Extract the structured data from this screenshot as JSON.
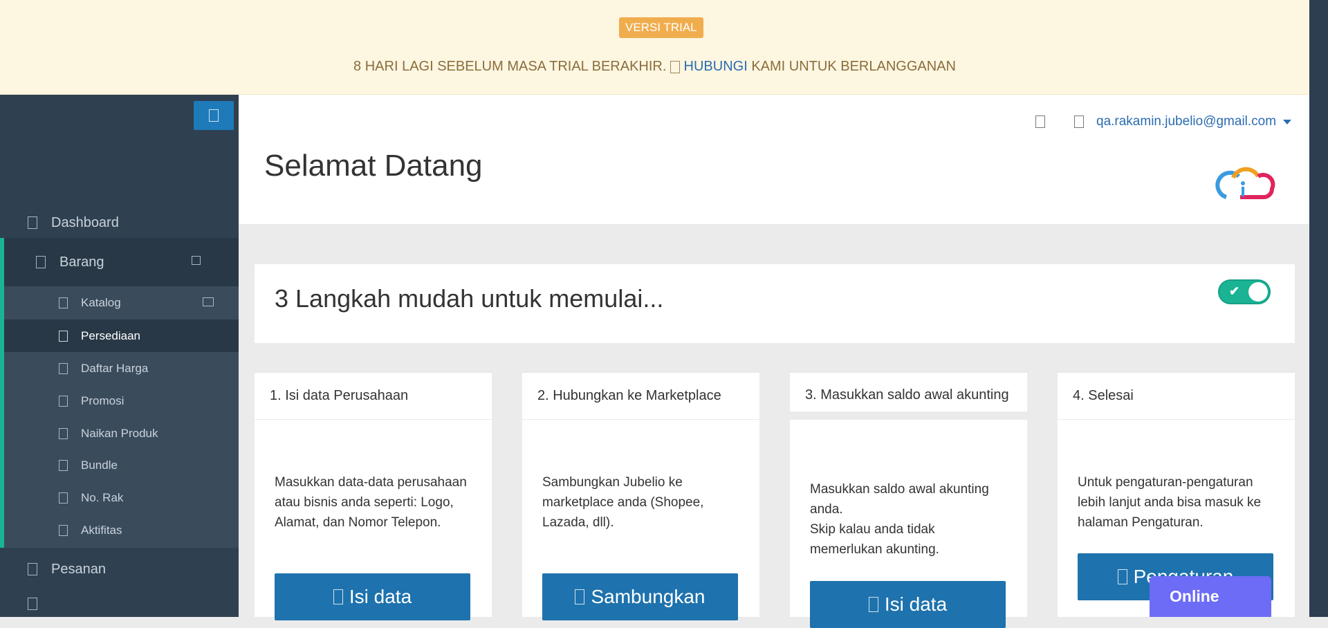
{
  "banner": {
    "badge": "VERSI TRIAL",
    "message_pre": "8 HARI LAGI SEBELUM MASA TRIAL BERAKHIR.",
    "message_link": "HUBUNGI",
    "message_post": "KAMI UNTUK BERLANGGANAN"
  },
  "sidebar": {
    "items": [
      {
        "label": "Dashboard",
        "icon": "dashboard-icon"
      },
      {
        "label": "Barang",
        "icon": "box-icon"
      },
      {
        "label": "Pesanan",
        "icon": "cart-icon"
      }
    ],
    "sub_items": [
      {
        "label": "Katalog",
        "icon": "catalog-icon"
      },
      {
        "label": "Persediaan",
        "icon": "stock-icon",
        "active": true
      },
      {
        "label": "Daftar Harga",
        "icon": "price-icon"
      },
      {
        "label": "Promosi",
        "icon": "promo-icon"
      },
      {
        "label": "Naikan Produk",
        "icon": "boost-icon"
      },
      {
        "label": "Bundle",
        "icon": "bundle-icon"
      },
      {
        "label": "No. Rak",
        "icon": "shelf-icon"
      },
      {
        "label": "Aktifitas",
        "icon": "activity-icon"
      }
    ]
  },
  "header": {
    "user_email": "qa.rakamin.jubelio@gmail.com",
    "page_title": "Selamat Datang"
  },
  "steps": {
    "title": "3 Langkah mudah untuk memulai...",
    "toggle_on": true
  },
  "cards": [
    {
      "title": "1. Isi data Perusahaan",
      "body": "Masukkan data-data perusahaan atau bisnis anda seperti: Logo, Alamat, dan Nomor Telepon.",
      "button": "Isi data"
    },
    {
      "title": "2. Hubungkan ke Marketplace",
      "body": "Sambungkan Jubelio ke marketplace anda (Shopee, Lazada, dll).",
      "button": "Sambungkan"
    },
    {
      "title": "3. Masukkan saldo awal akunting",
      "body": "Masukkan saldo awal akunting anda.",
      "body2": "Skip kalau anda tidak memerlukan akunting.",
      "button": "Isi data"
    },
    {
      "title": "4. Selesai",
      "body": "Untuk pengaturan-pengaturan lebih lanjut anda bisa masuk ke halaman Pengaturan.",
      "button": "Pengaturan"
    }
  ],
  "chat": {
    "label": "Online"
  },
  "colors": {
    "accent": "#1ab394",
    "primary": "#1e72ad",
    "sidebar": "#2f4050",
    "banner": "#fdf6e1"
  }
}
